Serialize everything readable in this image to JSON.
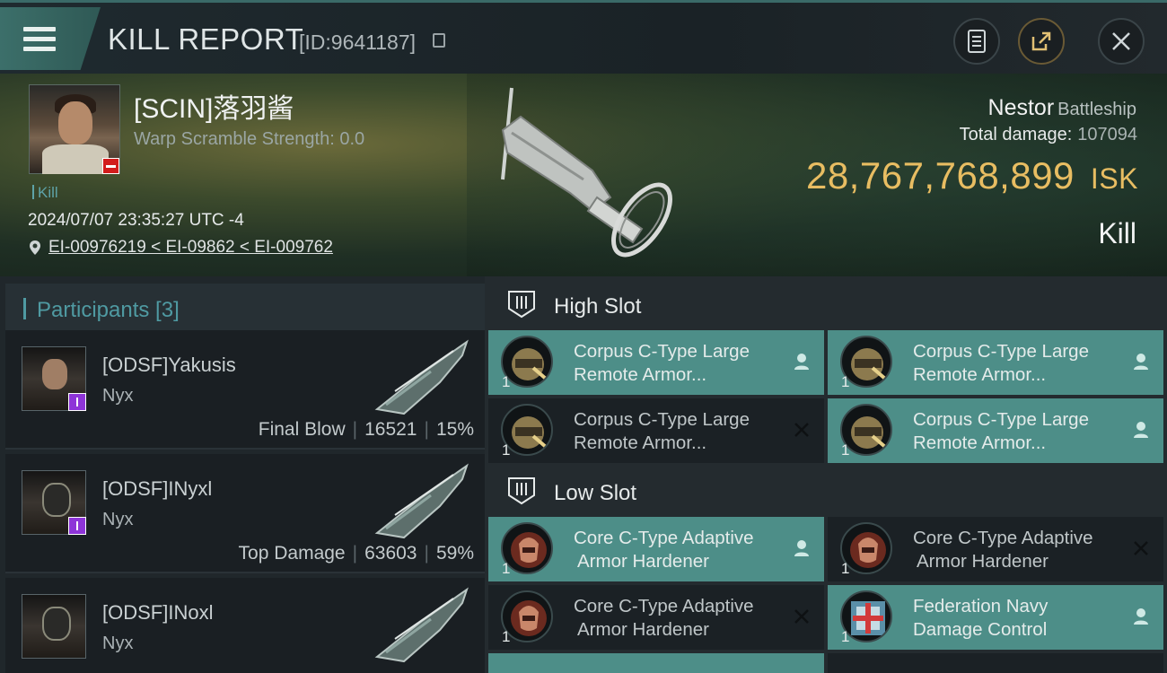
{
  "header": {
    "title": "KILL REPORT",
    "report_id": "[ID:9641187]"
  },
  "victim": {
    "name": "[SCIN]落羽酱",
    "warp_scramble": "Warp Scramble Strength: 0.0",
    "tag": "Kill",
    "datetime": "2024/07/07 23:35:27 UTC -4",
    "location": "EI-00976219 < EI-09862 < EI-009762",
    "ship_name": "Nestor",
    "ship_class": "Battleship",
    "total_damage_label": "Total damage:",
    "total_damage": "107094",
    "isk_value": "28,767,768,899",
    "isk_unit": "ISK",
    "result": "Kill"
  },
  "participants": {
    "label": "Participants [3]",
    "items": [
      {
        "name": "[ODSF]Yakusis",
        "ship": "Nyx",
        "role": "Final Blow",
        "damage": "16521",
        "percent": "15%"
      },
      {
        "name": "[ODSF]INyxl",
        "ship": "Nyx",
        "role": "Top Damage",
        "damage": "63603",
        "percent": "59%"
      },
      {
        "name": "[ODSF]INoxl",
        "ship": "Nyx",
        "role": "",
        "damage": "",
        "percent": ""
      }
    ]
  },
  "high_slot": {
    "label": "High Slot",
    "modules": [
      {
        "line1": "Corpus C-Type Large",
        "line2": "Remote Armor...",
        "qty": "1",
        "status": "person-icon"
      },
      {
        "line1": "Corpus C-Type Large",
        "line2": "Remote Armor...",
        "qty": "1",
        "status": "person-icon"
      },
      {
        "line1": "Corpus C-Type Large",
        "line2": "Remote Armor...",
        "qty": "1",
        "status": "close-icon"
      },
      {
        "line1": "Corpus C-Type Large",
        "line2": "Remote Armor...",
        "qty": "1",
        "status": "person-icon"
      }
    ]
  },
  "low_slot": {
    "label": "Low Slot",
    "modules": [
      {
        "line1": "Core C-Type Adaptive",
        "line2": "Armor Hardener",
        "qty": "1",
        "status": "person-icon"
      },
      {
        "line1": "Core C-Type Adaptive",
        "line2": "Armor Hardener",
        "qty": "1",
        "status": "close-icon"
      },
      {
        "line1": "Core C-Type Adaptive",
        "line2": "Armor Hardener",
        "qty": "1",
        "status": "close-icon"
      },
      {
        "line1": "Federation Navy",
        "line2": "Damage Control",
        "qty": "1",
        "status": "person-icon"
      }
    ]
  },
  "colors": {
    "accent_teal": "#4d8e88",
    "isk_gold": "#e8bd62",
    "participant_label": "#4f9aa2"
  }
}
